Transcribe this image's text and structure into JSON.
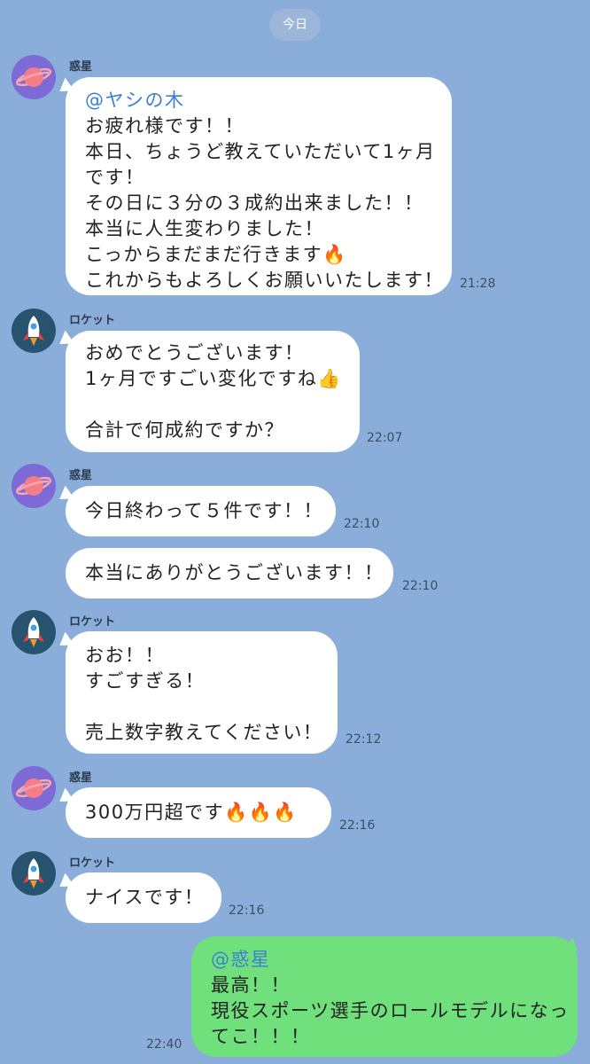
{
  "date_label": "今日",
  "messages": [
    {
      "sender": "惑星",
      "mention": "@ヤシの木",
      "lines": [
        "お疲れ様です！！",
        "本日、ちょうど教えていただいて1ヶ月",
        "です！",
        "その日に３分の３成約出来ました！！",
        "本当に人生変わりました！",
        "こっからまだまだ行きます🔥",
        "これからもよろしくお願いいたします！"
      ],
      "time": "21:28"
    },
    {
      "sender": "ロケット",
      "lines": [
        "おめでとうございます！",
        "1ヶ月ですごい変化ですね👍",
        "",
        "合計で何成約ですか？"
      ],
      "time": "22:07"
    },
    {
      "sender": "惑星",
      "lines": [
        "今日終わって５件です！！"
      ],
      "time": "22:10"
    },
    {
      "lines": [
        "本当にありがとうございます！！"
      ],
      "time": "22:10"
    },
    {
      "sender": "ロケット",
      "lines": [
        "おお！！",
        "すごすぎる！",
        "",
        "売上数字教えてください！"
      ],
      "time": "22:12"
    },
    {
      "sender": "惑星",
      "lines": [
        "300万円超です🔥🔥🔥"
      ],
      "time": "22:16"
    },
    {
      "sender": "ロケット",
      "lines": [
        "ナイスです！"
      ],
      "time": "22:16"
    },
    {
      "mention": "@惑星",
      "lines": [
        "最高！！",
        "現役スポーツ選手のロールモデルになっ",
        "てこ！！！"
      ],
      "time": "22:40"
    }
  ],
  "colors": {
    "background": "#8aaed9",
    "incoming_bubble": "#ffffff",
    "outgoing_bubble": "#6fe07c",
    "mention": "#3f7fd3",
    "planet_avatar": "#7d6ad6",
    "rocket_avatar": "#27536f"
  },
  "icons": {
    "planet_avatar": "planet-icon",
    "rocket_avatar": "rocket-icon"
  }
}
